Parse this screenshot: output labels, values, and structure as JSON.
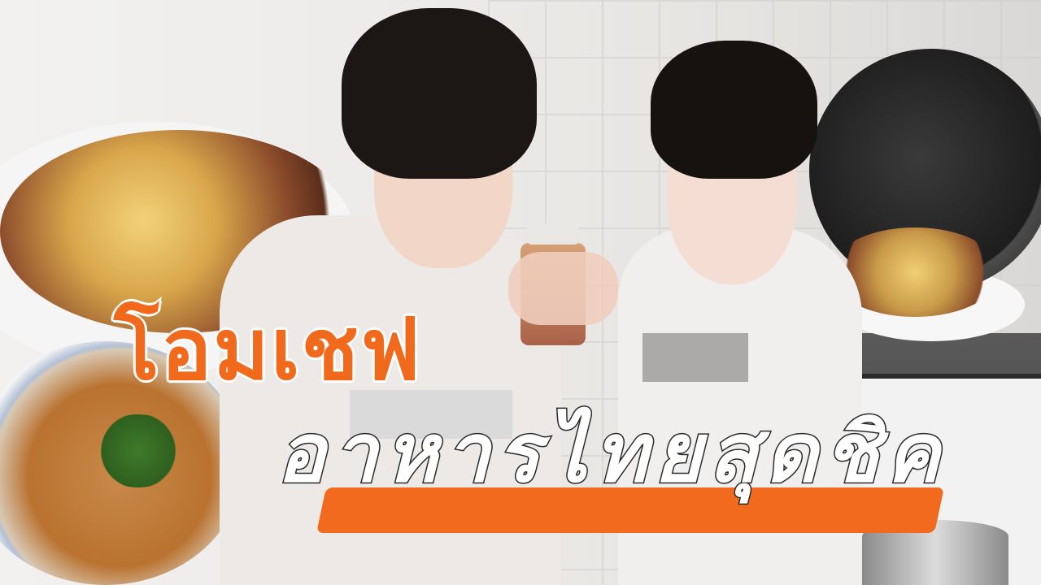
{
  "title": {
    "line1": "โอมเชฟ",
    "line2": "อาหารไทยสุดชิค"
  },
  "colors": {
    "accent_orange": "#f16a1c",
    "text_white": "#ffffff",
    "outline_dark": "#2a2a2a"
  }
}
